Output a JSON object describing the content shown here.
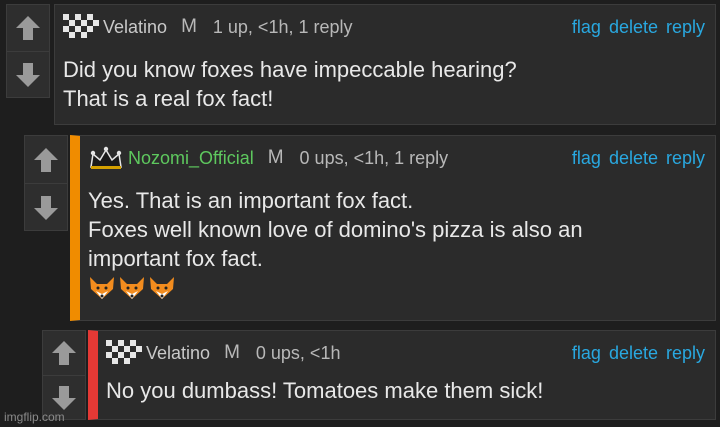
{
  "comments": [
    {
      "username": "Velatino",
      "gender": "M",
      "meta": "1 up, <1h, 1 reply",
      "lines": [
        "Did you know foxes have impeccable hearing?",
        "That is a real fox fact!"
      ]
    },
    {
      "username": "Nozomi_Official",
      "gender": "M",
      "meta": "0 ups, <1h, 1 reply",
      "lines": [
        "Yes. That is an important fox fact.",
        "Foxes well known love of domino's pizza is also an",
        "important fox fact."
      ],
      "emoji_count": 3,
      "emoji": "fox-face-icon"
    },
    {
      "username": "Velatino",
      "gender": "M",
      "meta": "0 ups, <1h",
      "lines": [
        "No you dumbass! Tomatoes make them sick!"
      ]
    }
  ],
  "actions": {
    "flag": "flag",
    "delete": "delete",
    "reply": "reply"
  },
  "watermark": "imgflip.com",
  "colors": {
    "link": "#29a8e0",
    "op_username": "#5ec85e",
    "reply_bar_orange": "#f08c00",
    "reply_bar_red": "#e53935"
  }
}
